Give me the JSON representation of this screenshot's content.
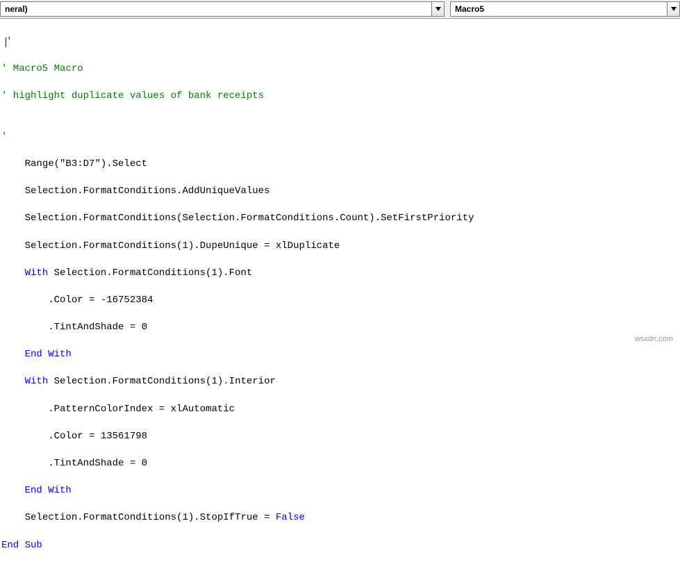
{
  "dropdowns": {
    "object_value": "neral)",
    "procedure_value": "Macro5"
  },
  "code": {
    "l01": "'",
    "l02": "' Macro5 Macro",
    "l03": "' highlight duplicate values of bank receipts",
    "l04": "",
    "l05": "'",
    "l06_indent": "    ",
    "l06_text": "Range(\"B3:D7\").Select",
    "l07_indent": "    ",
    "l07_text": "Selection.FormatConditions.AddUniqueValues",
    "l08_indent": "    ",
    "l08_text": "Selection.FormatConditions(Selection.FormatConditions.Count).SetFirstPriority",
    "l09_indent": "    ",
    "l09_text": "Selection.FormatConditions(1).DupeUnique = xlDuplicate",
    "l10_indent": "    ",
    "l10_kw": "With",
    "l10_rest": " Selection.FormatConditions(1).Font",
    "l11_indent": "        ",
    "l11_text": ".Color = -16752384",
    "l12_indent": "        ",
    "l12_text": ".TintAndShade = 0",
    "l13_indent": "    ",
    "l13_kw": "End With",
    "l14_indent": "    ",
    "l14_kw": "With",
    "l14_rest": " Selection.FormatConditions(1).Interior",
    "l15_indent": "        ",
    "l15_text": ".PatternColorIndex = xlAutomatic",
    "l16_indent": "        ",
    "l16_text": ".Color = 13561798",
    "l17_indent": "        ",
    "l17_text": ".TintAndShade = 0",
    "l18_indent": "    ",
    "l18_kw": "End With",
    "l19_indent": "    ",
    "l19_text1": "Selection.FormatConditions(1).StopIfTrue = ",
    "l19_kw": "False",
    "l20_kw": "End Sub"
  },
  "watermark": "wsxdn.com"
}
